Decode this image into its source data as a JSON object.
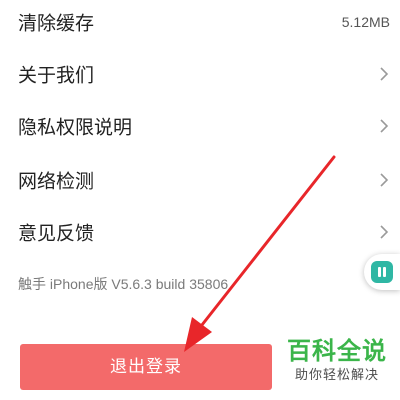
{
  "settings": {
    "items": [
      {
        "label": "清除缓存",
        "value": "5.12MB"
      },
      {
        "label": "关于我们",
        "icon": "chevron-right-icon"
      },
      {
        "label": "隐私权限说明",
        "icon": "chevron-right-icon"
      },
      {
        "label": "网络检测",
        "icon": "chevron-right-icon"
      },
      {
        "label": "意见反馈",
        "icon": "chevron-right-icon"
      }
    ],
    "version_text": "触手 iPhone版 V5.6.3 build 35806"
  },
  "floating_tab": {
    "icon": "pause-icon",
    "color": "#2fb7a4"
  },
  "logout_button": {
    "label": "退出登录",
    "color": "#f36a6a"
  },
  "annotation": {
    "icon": "red-arrow-icon",
    "color": "#e8262a"
  },
  "watermark": {
    "title": "百科全说",
    "subtitle": "助你轻松解决",
    "color": "#3bb54a"
  }
}
